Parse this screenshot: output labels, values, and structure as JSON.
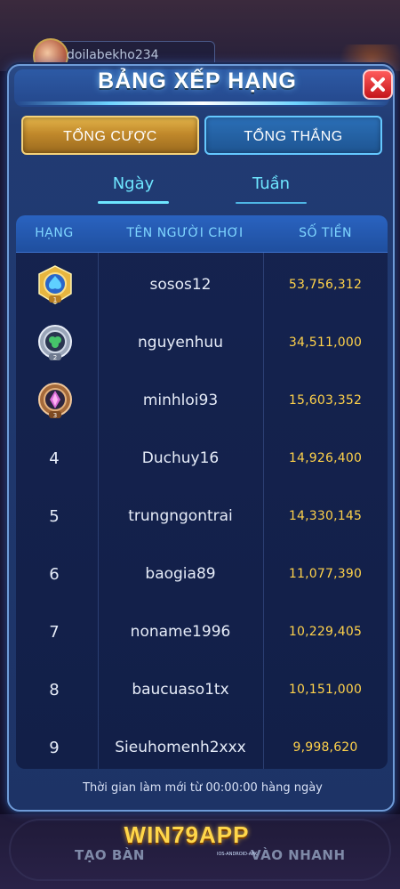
{
  "background": {
    "username": "doilabekho234",
    "left_button": "TẠO BÀN",
    "right_button": "VÀO NHANH"
  },
  "panel": {
    "title": "BẢNG XẾP HẠNG",
    "close_icon": "close-icon"
  },
  "tabs": [
    {
      "label": "TỔNG CƯỢC",
      "active": true
    },
    {
      "label": "TỔNG THẮNG",
      "active": false
    }
  ],
  "subtabs": [
    {
      "label": "Ngày",
      "active": true
    },
    {
      "label": "Tuần",
      "active": false
    }
  ],
  "table": {
    "headers": [
      "HẠNG",
      "TÊN NGƯỜI CHƠI",
      "SỐ TIỀN"
    ],
    "rows": [
      {
        "rank": "1",
        "name": "sosos12",
        "amount": "53,756,312"
      },
      {
        "rank": "2",
        "name": "nguyenhuu",
        "amount": "34,511,000"
      },
      {
        "rank": "3",
        "name": "minhloi93",
        "amount": "15,603,352"
      },
      {
        "rank": "4",
        "name": "Duchuy16",
        "amount": "14,926,400"
      },
      {
        "rank": "5",
        "name": "trungngontrai",
        "amount": "14,330,145"
      },
      {
        "rank": "6",
        "name": "baogia89",
        "amount": "11,077,390"
      },
      {
        "rank": "7",
        "name": "noname1996",
        "amount": "10,229,405"
      },
      {
        "rank": "8",
        "name": "baucuaso1tx",
        "amount": "10,151,000"
      },
      {
        "rank": "9",
        "name": "Sieuhomenh2xxx",
        "amount": "9,998,620"
      }
    ]
  },
  "footer_note": "Thời gian làm mới từ 00:00:00 hàng ngày",
  "logo": {
    "text": "WIN79APP",
    "sub": "IOS-ANDROID-APK"
  },
  "colors": {
    "accent_gold": "#ffd24a",
    "panel_blue": "#213b73",
    "tab_active": "#c1892b",
    "tab_inactive": "#1e5592",
    "close_red": "#c4151a"
  }
}
